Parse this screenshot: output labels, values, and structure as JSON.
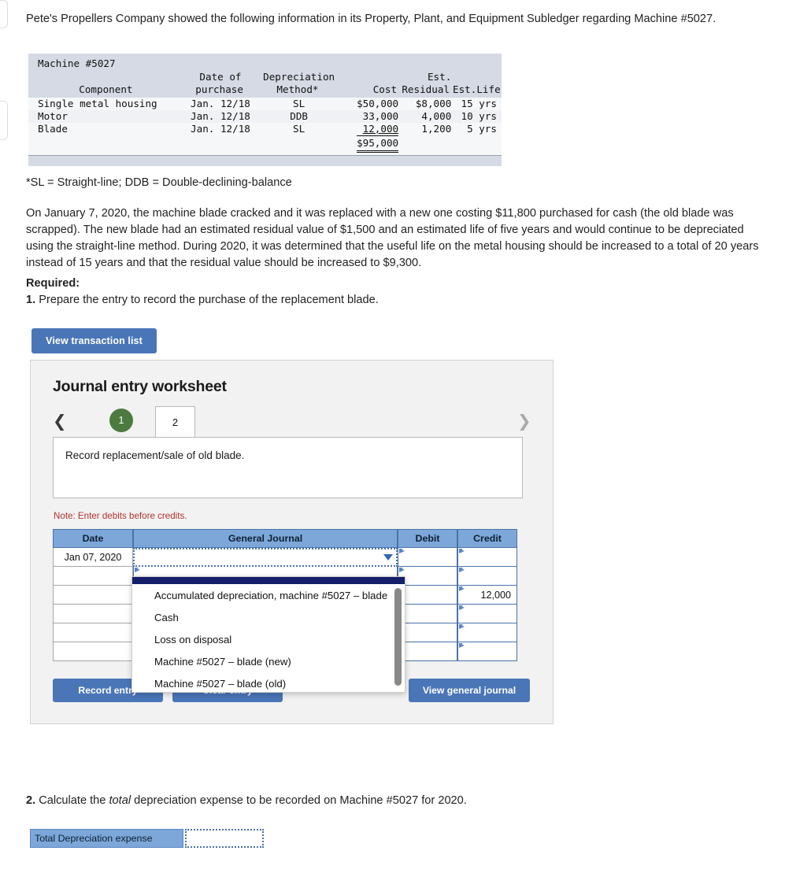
{
  "intro": {
    "text": "Pete's Propellers Company showed the following information in its Property, Plant, and Equipment Subledger regarding Machine #5027."
  },
  "subledger": {
    "title": "Machine #5027",
    "headers_line1": {
      "date": "Date of",
      "method": "Depreciation",
      "cost": "",
      "residual": "Est.",
      "life": ""
    },
    "headers_line2": {
      "component": "Component",
      "date": "purchase",
      "method": "Method*",
      "cost": "Cost",
      "residual": "Residual",
      "life": "Est.Life"
    },
    "rows": [
      {
        "component": "Single metal housing",
        "date": "Jan. 12/18",
        "method": "SL",
        "cost": "$50,000",
        "residual": "$8,000",
        "life": "15 yrs"
      },
      {
        "component": "Motor",
        "date": "Jan. 12/18",
        "method": "DDB",
        "cost": "33,000",
        "residual": "4,000",
        "life": "10 yrs"
      },
      {
        "component": "Blade",
        "date": "Jan. 12/18",
        "method": "SL",
        "cost": "12,000",
        "residual": "1,200",
        "life": "5 yrs"
      }
    ],
    "total": "$95,000"
  },
  "footnote": "*SL = Straight-line; DDB = Double-declining-balance",
  "body": "On January 7, 2020, the machine blade cracked and it was replaced with a new one costing $11,800 purchased for cash (the old blade was scrapped). The new blade had an estimated residual value of $1,500 and an estimated life of five years and would continue to be depreciated using the straight-line method. During 2020, it was determined that the useful life on the metal housing should be increased to a total of 20 years instead of 15 years and that the residual value should be increased to $9,300.",
  "required": {
    "heading": "Required:",
    "item1_num": "1.",
    "item1_text": "Prepare the entry to record the purchase of the replacement blade."
  },
  "buttons": {
    "view_transaction_list": "View transaction list",
    "record_entry": "Record entry",
    "clear_entry": "Clear entry",
    "view_general_journal": "View general journal"
  },
  "worksheet": {
    "title": "Journal entry worksheet",
    "prev_icon": "chevron-left-icon",
    "next_icon": "chevron-right-icon",
    "tabs": [
      {
        "label": "1",
        "state": "completed"
      },
      {
        "label": "2",
        "state": "active"
      }
    ],
    "instruction": "Record replacement/sale of old blade.",
    "note": "Note: Enter debits before credits.",
    "table": {
      "columns": [
        "Date",
        "General Journal",
        "Debit",
        "Credit"
      ],
      "rows": [
        {
          "date": "Jan 07, 2020",
          "account": "",
          "debit": "",
          "credit": "",
          "selected": true
        },
        {
          "date": "",
          "account": "",
          "debit": "",
          "credit": ""
        },
        {
          "date": "",
          "account": "",
          "debit": "",
          "credit": "12,000"
        },
        {
          "date": "",
          "account": "",
          "debit": "",
          "credit": ""
        },
        {
          "date": "",
          "account": "",
          "debit": "",
          "credit": ""
        },
        {
          "date": "",
          "account": "",
          "debit": "",
          "credit": ""
        }
      ]
    },
    "dropdown": {
      "open": true,
      "options": [
        "Accumulated depreciation, machine #5027 – blade",
        "Cash",
        "Loss on disposal",
        "Machine #5027 – blade (new)",
        "Machine #5027 – blade (old)"
      ]
    }
  },
  "part2": {
    "num": "2.",
    "text_a": "Calculate the",
    "text_italic": "total",
    "text_b": "depreciation expense to be recorded on Machine #5027 for 2020.",
    "answer_label": "Total Depreciation expense",
    "answer_value": ""
  },
  "colors": {
    "button_blue": "#4a76b8",
    "table_header_blue": "#7da7d9",
    "tab_done_green": "#4c7a3f",
    "note_red": "#b1332e",
    "subledger_header_gray": "#d5dae4",
    "dropdown_top_navy": "#141f6b"
  }
}
